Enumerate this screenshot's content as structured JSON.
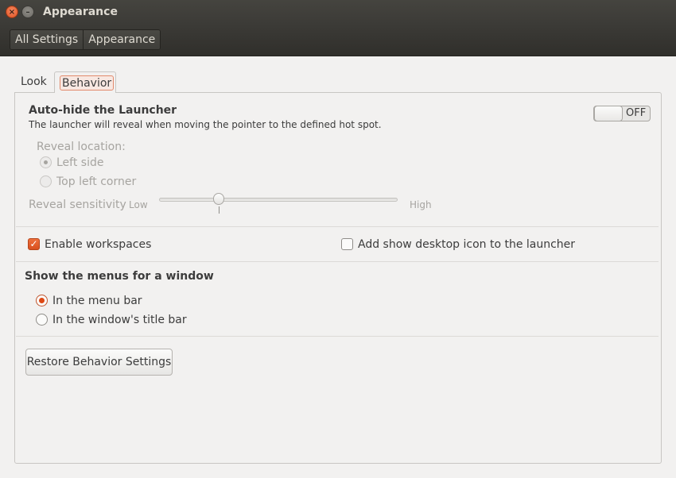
{
  "window": {
    "title": "Appearance"
  },
  "breadcrumb": {
    "items": [
      "All Settings",
      "Appearance"
    ]
  },
  "tabs": [
    {
      "label": "Look",
      "selected": false
    },
    {
      "label": "Behavior",
      "selected": true
    }
  ],
  "autohide": {
    "title": "Auto-hide the Launcher",
    "description": "The launcher will reveal when moving the pointer to the defined hot spot.",
    "switch_state": "OFF",
    "reveal_location_label": "Reveal location:",
    "options": [
      "Left side",
      "Top left corner"
    ],
    "selected_option": "Left side",
    "sensitivity_label": "Reveal sensitivity",
    "low_label": "Low",
    "high_label": "High",
    "sensitivity_value": 0.25
  },
  "workspaces": {
    "label": "Enable workspaces",
    "checked": true
  },
  "show_desktop": {
    "label": "Add show desktop icon to the launcher",
    "checked": false
  },
  "menus": {
    "title": "Show the menus for a window",
    "options": [
      "In the menu bar",
      "In the window's title bar"
    ],
    "selected": "In the menu bar"
  },
  "restore_button": "Restore Behavior Settings",
  "colors": {
    "accent": "#dd4814",
    "titlebar": "#3c3b37",
    "background": "#f2f1f0"
  }
}
